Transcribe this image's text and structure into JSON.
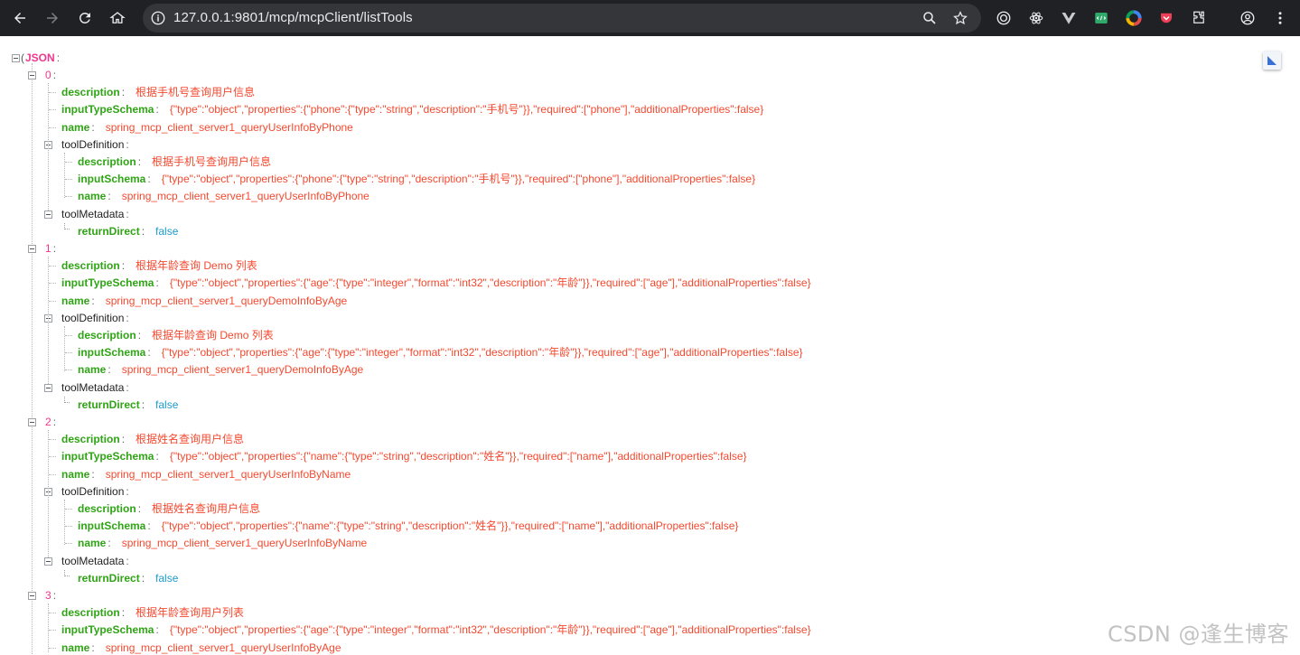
{
  "browser": {
    "url": "127.0.0.1:9801/mcp/mcpClient/listTools"
  },
  "json_root_label": "JSON",
  "colon": ":",
  "labels": {
    "description": "description",
    "inputTypeSchema": "inputTypeSchema",
    "name": "name",
    "toolDefinition": "toolDefinition",
    "inputSchema": "inputSchema",
    "toolMetadata": "toolMetadata",
    "returnDirect": "returnDirect"
  },
  "tools": [
    {
      "index": "0",
      "description": "根据手机号查询用户信息",
      "inputTypeSchema": "{\"type\":\"object\",\"properties\":{\"phone\":{\"type\":\"string\",\"description\":\"手机号\"}},\"required\":[\"phone\"],\"additionalProperties\":false}",
      "name": "spring_mcp_client_server1_queryUserInfoByPhone",
      "toolDefinition": {
        "description": "根据手机号查询用户信息",
        "inputSchema": "{\"type\":\"object\",\"properties\":{\"phone\":{\"type\":\"string\",\"description\":\"手机号\"}},\"required\":[\"phone\"],\"additionalProperties\":false}",
        "name": "spring_mcp_client_server1_queryUserInfoByPhone"
      },
      "toolMetadata": {
        "returnDirect": "false"
      }
    },
    {
      "index": "1",
      "description": "根据年龄查询 Demo 列表",
      "inputTypeSchema": "{\"type\":\"object\",\"properties\":{\"age\":{\"type\":\"integer\",\"format\":\"int32\",\"description\":\"年龄\"}},\"required\":[\"age\"],\"additionalProperties\":false}",
      "name": "spring_mcp_client_server1_queryDemoInfoByAge",
      "toolDefinition": {
        "description": "根据年龄查询 Demo 列表",
        "inputSchema": "{\"type\":\"object\",\"properties\":{\"age\":{\"type\":\"integer\",\"format\":\"int32\",\"description\":\"年龄\"}},\"required\":[\"age\"],\"additionalProperties\":false}",
        "name": "spring_mcp_client_server1_queryDemoInfoByAge"
      },
      "toolMetadata": {
        "returnDirect": "false"
      }
    },
    {
      "index": "2",
      "description": "根据姓名查询用户信息",
      "inputTypeSchema": "{\"type\":\"object\",\"properties\":{\"name\":{\"type\":\"string\",\"description\":\"姓名\"}},\"required\":[\"name\"],\"additionalProperties\":false}",
      "name": "spring_mcp_client_server1_queryUserInfoByName",
      "toolDefinition": {
        "description": "根据姓名查询用户信息",
        "inputSchema": "{\"type\":\"object\",\"properties\":{\"name\":{\"type\":\"string\",\"description\":\"姓名\"}},\"required\":[\"name\"],\"additionalProperties\":false}",
        "name": "spring_mcp_client_server1_queryUserInfoByName"
      },
      "toolMetadata": {
        "returnDirect": "false"
      }
    },
    {
      "index": "3",
      "description": "根据年龄查询用户列表",
      "inputTypeSchema": "{\"type\":\"object\",\"properties\":{\"age\":{\"type\":\"integer\",\"format\":\"int32\",\"description\":\"年龄\"}},\"required\":[\"age\"],\"additionalProperties\":false}",
      "name": "spring_mcp_client_server1_queryUserInfoByAge"
    }
  ],
  "watermark": "CSDN @逢生博客"
}
